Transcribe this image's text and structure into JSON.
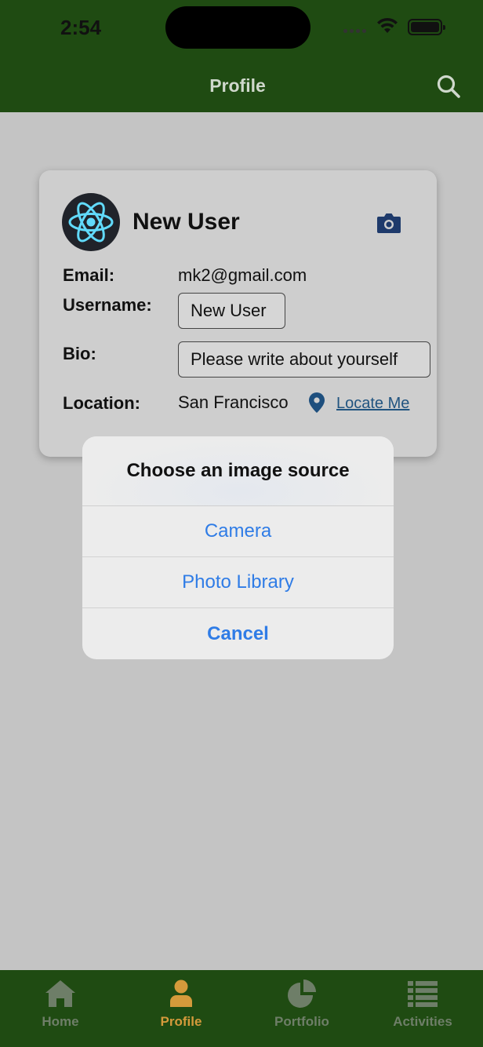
{
  "status_bar": {
    "time": "2:54"
  },
  "header": {
    "title": "Profile",
    "search_icon": "search-icon"
  },
  "profile": {
    "name": "New User",
    "avatar_icon": "react-logo",
    "fields": {
      "email_label": "Email:",
      "email_value": "mk2@gmail.com",
      "username_label": "Username:",
      "username_value": "New User",
      "bio_label": "Bio:",
      "bio_value": "Please write about yourself",
      "location_label": "Location:",
      "location_value": "San Francisco",
      "locate_link": "Locate Me"
    }
  },
  "action_sheet": {
    "title": "Choose an image source",
    "options": [
      "Camera",
      "Photo Library"
    ],
    "cancel": "Cancel"
  },
  "tabs": [
    {
      "label": "Home",
      "icon": "home-icon",
      "active": false
    },
    {
      "label": "Profile",
      "icon": "person-icon",
      "active": true
    },
    {
      "label": "Portfolio",
      "icon": "pie-chart-icon",
      "active": false
    },
    {
      "label": "Activities",
      "icon": "list-icon",
      "active": false
    }
  ],
  "colors": {
    "header_bg": "#1f4b12",
    "active_tab": "#d49a3b",
    "inactive_tab": "#6e7e68",
    "action_blue": "#2f7ce6",
    "camera_icon": "#1e3a6b"
  }
}
